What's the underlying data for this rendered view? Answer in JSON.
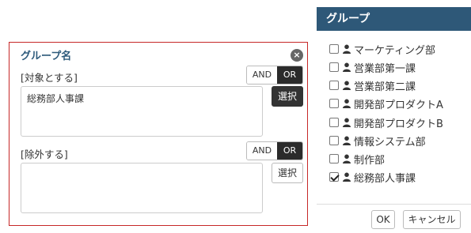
{
  "editor": {
    "title": "グループ名",
    "target_label": "[対象とする]",
    "target_value": "総務部人事課",
    "exclude_label": "[除外する]",
    "exclude_value": "",
    "and_label": "AND",
    "or_label": "OR",
    "select_label": "選択"
  },
  "group_panel": {
    "title": "グループ",
    "items": [
      {
        "label": "マーケティング部",
        "checked": false
      },
      {
        "label": "営業部第一課",
        "checked": false
      },
      {
        "label": "営業部第二課",
        "checked": false
      },
      {
        "label": "開発部プロダクトA",
        "checked": false
      },
      {
        "label": "開発部プロダクトB",
        "checked": false
      },
      {
        "label": "情報システム部",
        "checked": false
      },
      {
        "label": "制作部",
        "checked": false
      },
      {
        "label": "総務部人事課",
        "checked": true
      }
    ]
  },
  "footer": {
    "ok_label": "OK",
    "cancel_label": "キャンセル"
  }
}
